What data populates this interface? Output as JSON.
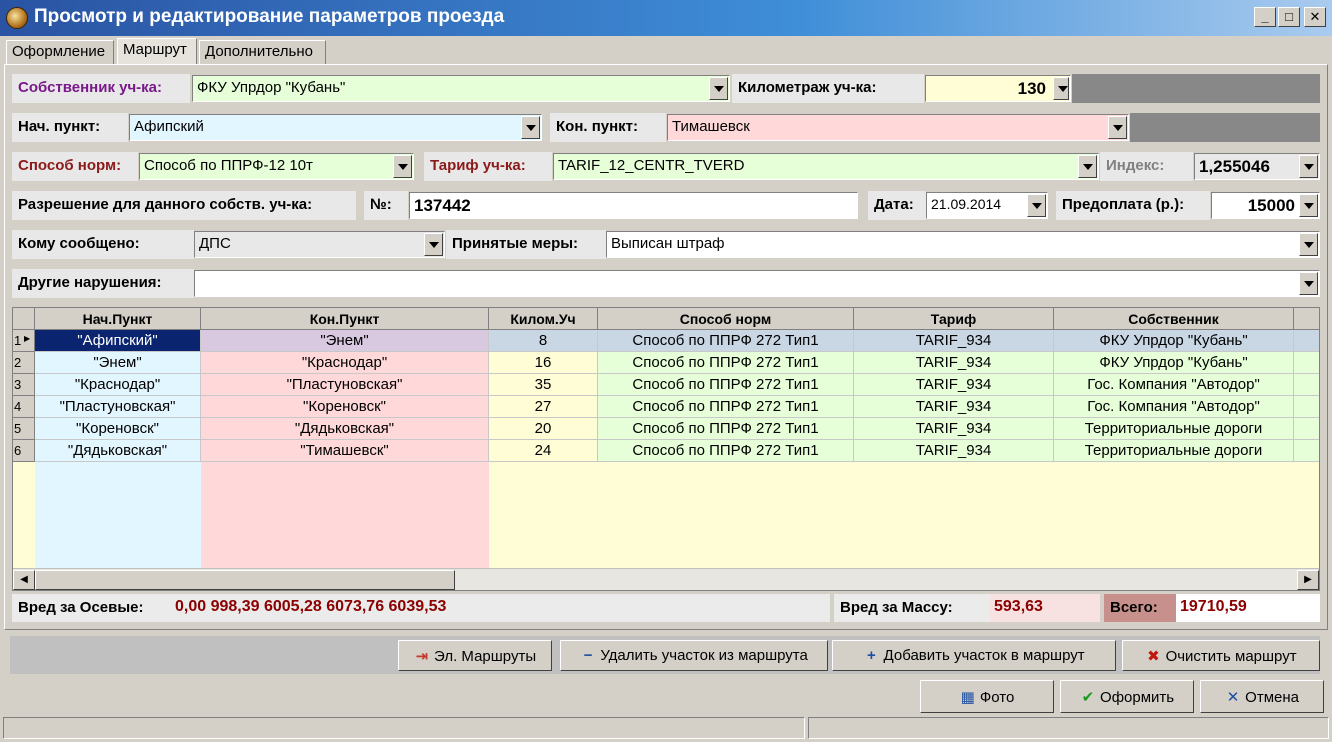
{
  "window": {
    "title": "Просмотр и редактирование параметров проезда",
    "min": "_",
    "max": "□",
    "close": "✕"
  },
  "tabs": [
    "Оформление",
    "Маршрут",
    "Дополнительно"
  ],
  "form": {
    "owner_label": "Собственник уч-ка:",
    "owner_value": "ФКУ Упрдор \"Кубань\"",
    "km_label": "Километраж уч-ка:",
    "km_value": "130",
    "start_label": "Нач. пункт:",
    "start_value": "Афипский",
    "end_label": "Кон. пункт:",
    "end_value": "Тимашевск",
    "norm_label": "Способ норм:",
    "norm_value": "Способ по ППРФ-12 10т",
    "tariff_label": "Тариф уч-ка:",
    "tariff_value": "TARIF_12_CENTR_TVERD",
    "index_label": "Индекс:",
    "index_value": "1,255046",
    "permit_label": "Разрешение для данного собств. уч-ка:",
    "num_label": "№:",
    "num_value": "137442",
    "date_label": "Дата:",
    "date_value": "21.09.2014",
    "prepay_label": "Предоплата (р.):",
    "prepay_value": "15000",
    "notified_label": "Кому сообщено:",
    "notified_value": "ДПС",
    "measures_label": "Принятые меры:",
    "measures_value": "Выписан штраф",
    "other_label": "Другие нарушения:",
    "other_value": ""
  },
  "grid": {
    "columns": [
      "Нач.Пункт",
      "Кон.Пункт",
      "Килом.Уч",
      "Способ норм",
      "Тариф",
      "Собственник"
    ],
    "rows": [
      {
        "n": "1",
        "start": "\"Афипский\"",
        "end": "\"Энем\"",
        "km": "8",
        "norm": "Способ по ППРФ 272 Тип1",
        "tariff": "TARIF_934",
        "owner": "ФКУ Упрдор \"Кубань\""
      },
      {
        "n": "2",
        "start": "\"Энем\"",
        "end": "\"Краснодар\"",
        "km": "16",
        "norm": "Способ по ППРФ 272 Тип1",
        "tariff": "TARIF_934",
        "owner": "ФКУ Упрдор \"Кубань\""
      },
      {
        "n": "3",
        "start": "\"Краснодар\"",
        "end": "\"Пластуновская\"",
        "km": "35",
        "norm": "Способ по ППРФ 272 Тип1",
        "tariff": "TARIF_934",
        "owner": "Гос. Компания \"Автодор\""
      },
      {
        "n": "4",
        "start": "\"Пластуновская\"",
        "end": "\"Кореновск\"",
        "km": "27",
        "norm": "Способ по ППРФ 272 Тип1",
        "tariff": "TARIF_934",
        "owner": "Гос. Компания \"Автодор\""
      },
      {
        "n": "5",
        "start": "\"Кореновск\"",
        "end": "\"Дядьковская\"",
        "km": "20",
        "norm": "Способ по ППРФ 272 Тип1",
        "tariff": "TARIF_934",
        "owner": "Территориальные дороги"
      },
      {
        "n": "6",
        "start": "\"Дядьковская\"",
        "end": "\"Тимашевск\"",
        "km": "24",
        "norm": "Способ по ППРФ 272 Тип1",
        "tariff": "TARIF_934",
        "owner": "Территориальные дороги"
      }
    ]
  },
  "totals": {
    "axle_label": "Вред за Осевые:",
    "axle_value": "0,00 998,39 6005,28 6073,76 6039,53",
    "mass_label": "Вред  за Массу:",
    "mass_value": "593,63",
    "total_label": "Всего:",
    "total_value": "19710,59"
  },
  "actions": {
    "routes": "Эл. Маршруты",
    "remove": "Удалить участок из маршрута",
    "add": "Добавить участок в маршрут",
    "clear": "Очистить маршрут"
  },
  "footer": {
    "photo": "Фото",
    "submit": "Оформить",
    "cancel": "Отмена"
  },
  "colors": {
    "title_start": "#2a53a3",
    "grid_selected": "#0a2470",
    "value_red": "#8b0000"
  }
}
